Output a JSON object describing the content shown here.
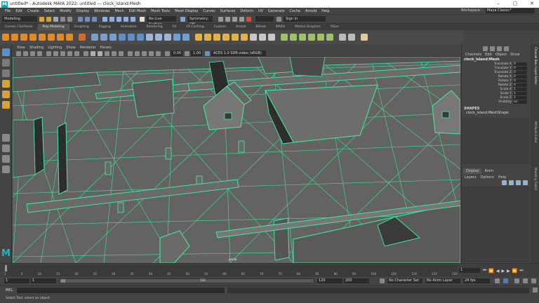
{
  "window": {
    "title": "untitled* - Autodesk MAYA 2022: untitled   ---   clock_island:Mesh",
    "logo": "M",
    "minimize": "–",
    "maximize": "▢",
    "close": "✕"
  },
  "menubar": {
    "items": [
      "File",
      "Edit",
      "Create",
      "Select",
      "Modify",
      "Display",
      "Windows",
      "Mesh",
      "Edit Mesh",
      "Mesh Tools",
      "Mesh Display",
      "Curves",
      "Surfaces",
      "Deform",
      "UV",
      "Generate",
      "Cache",
      "Arnold",
      "Help"
    ],
    "workspace_label": "Workspace :",
    "workspace_value": "Maya Classic*"
  },
  "statusline": {
    "mode": "Modeling",
    "live_surface": "No Live Surface",
    "symmetry": "Symmetry: Off",
    "sign_in": "Sign In"
  },
  "shelf": {
    "tabs": [
      "Curves / Surfaces",
      "Poly Modeling",
      "Sculpting",
      "Rigging",
      "Animation",
      "Rendering",
      "FX",
      "FX Caching",
      "Custom",
      "Arnold",
      "Bifrost",
      "MASH",
      "Motion Graphics",
      "XGen"
    ],
    "active_tab": "Poly Modeling"
  },
  "viewport": {
    "menus": [
      "View",
      "Shading",
      "Lighting",
      "Show",
      "Renderer",
      "Panels"
    ],
    "field_a": "0.00",
    "field_b": "1.00",
    "color_space": "ACES 1.0 SDR-video (sRGB)",
    "camera_label": "persp",
    "colors": {
      "wire": "#3ef0a8",
      "ground": "#6b6b6b",
      "roof": "#7a7a7a",
      "dark": "#2d2d2d"
    }
  },
  "channelbox": {
    "menus": [
      "Channels",
      "Edit",
      "Object",
      "Show"
    ],
    "object": "clock_island:Mesh",
    "attributes": [
      {
        "name": "Translate X",
        "value": "0"
      },
      {
        "name": "Translate Y",
        "value": "0"
      },
      {
        "name": "Translate Z",
        "value": "0"
      },
      {
        "name": "Rotate X",
        "value": "0"
      },
      {
        "name": "Rotate Y",
        "value": "0"
      },
      {
        "name": "Rotate Z",
        "value": "0"
      },
      {
        "name": "Scale X",
        "value": "1"
      },
      {
        "name": "Scale Y",
        "value": "1"
      },
      {
        "name": "Scale Z",
        "value": "1"
      },
      {
        "name": "Visibility",
        "value": "on"
      }
    ],
    "shapes_header": "SHAPES",
    "shape_name": "clock_island:MeshShape"
  },
  "layereditor": {
    "tabs": [
      "Display",
      "Anim"
    ],
    "menus": [
      "Layers",
      "Options",
      "Help"
    ]
  },
  "sidetabs": [
    "Channel Box / Layer Editor",
    "Attribute Editor",
    "Modeling Toolkit"
  ],
  "timeline": {
    "ticks": [
      "1",
      "5",
      "10",
      "15",
      "20",
      "25",
      "30",
      "35",
      "40",
      "45",
      "50",
      "55",
      "60",
      "65",
      "70",
      "75",
      "80",
      "85",
      "90",
      "95",
      "100",
      "105",
      "110",
      "115",
      "120"
    ],
    "current_frame": "1",
    "range_start": "1",
    "range_start_inner": "1",
    "range_inner_end": "120",
    "range_end": "120",
    "anim_end": "200",
    "character_set": "No Character Set",
    "anim_layer": "No Anim Layer",
    "fps": "24 fps"
  },
  "cmdline": {
    "label": "MEL",
    "help": "Select Tool: select an object"
  }
}
